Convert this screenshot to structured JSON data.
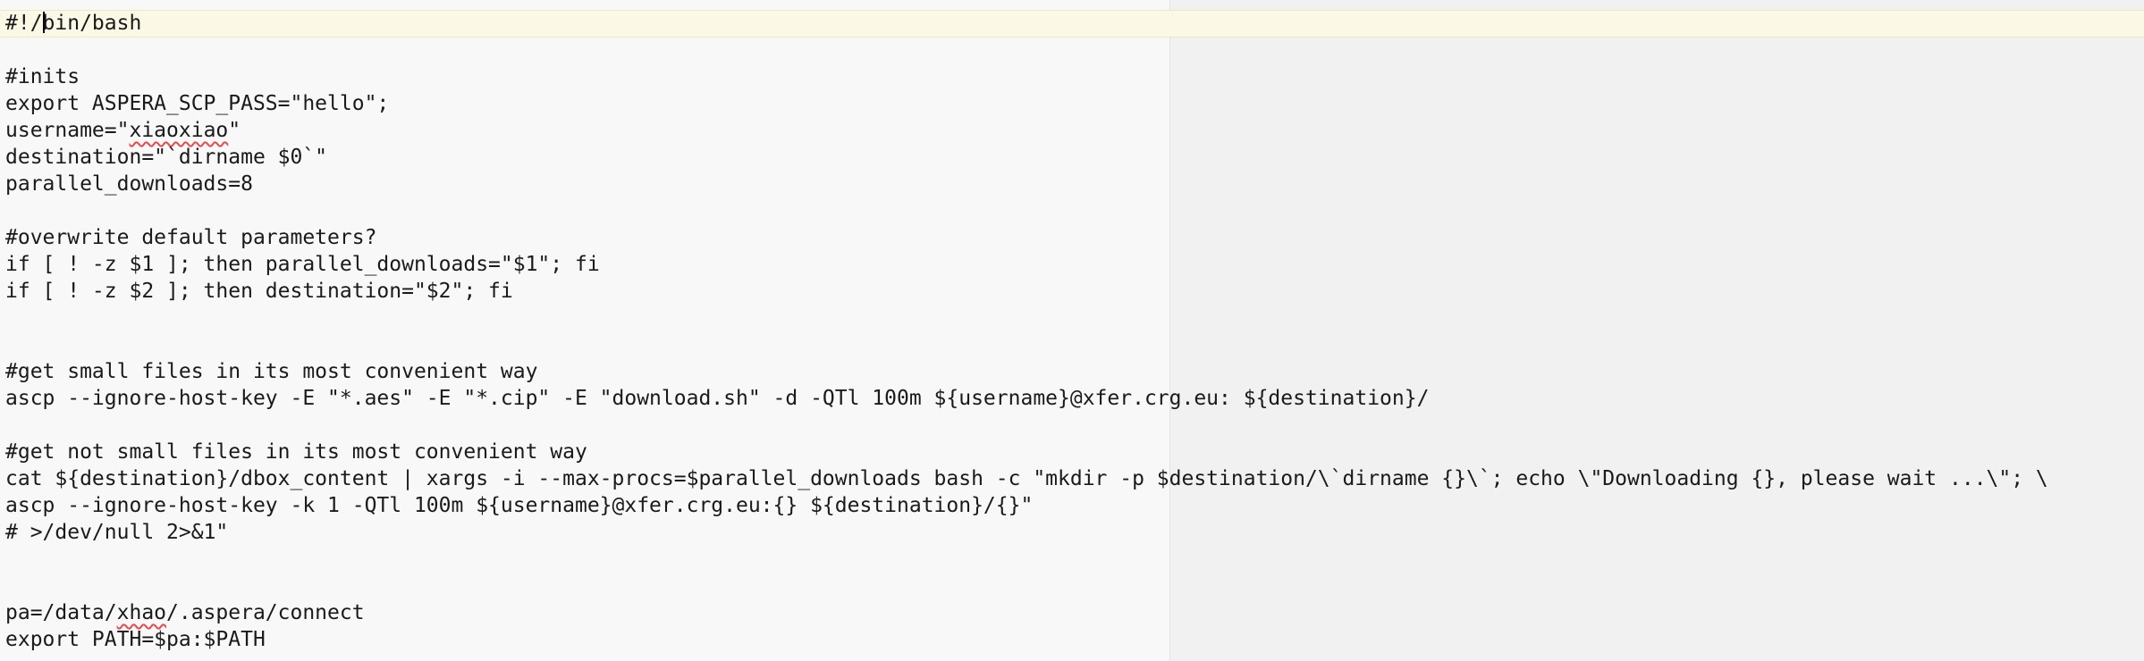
{
  "editor": {
    "lines": [
      {
        "segments": [
          "#!/",
          "bin/bash"
        ],
        "caret_after_first": true
      },
      {
        "text": ""
      },
      {
        "text": "#inits"
      },
      {
        "text": "export ASPERA_SCP_PASS=\"hello\";"
      },
      {
        "segments": [
          "username=\"",
          "xiaoxiao",
          "\""
        ],
        "misspelled_index": 1
      },
      {
        "text": "destination=\"`dirname $0`\""
      },
      {
        "text": "parallel_downloads=8"
      },
      {
        "text": ""
      },
      {
        "text": "#overwrite default parameters?"
      },
      {
        "text": "if [ ! -z $1 ]; then parallel_downloads=\"$1\"; fi"
      },
      {
        "text": "if [ ! -z $2 ]; then destination=\"$2\"; fi"
      },
      {
        "text": ""
      },
      {
        "text": ""
      },
      {
        "text": "#get small files in its most convenient way"
      },
      {
        "text": "ascp --ignore-host-key -E \"*.aes\" -E \"*.cip\" -E \"download.sh\" -d -QTl 100m ${username}@xfer.crg.eu: ${destination}/"
      },
      {
        "text": ""
      },
      {
        "text": "#get not small files in its most convenient way"
      },
      {
        "text": "cat ${destination}/dbox_content | xargs -i --max-procs=$parallel_downloads bash -c \"mkdir -p $destination/\\`dirname {}\\`; echo \\\"Downloading {}, please wait ...\\\"; \\"
      },
      {
        "text": "ascp --ignore-host-key -k 1 -QTl 100m ${username}@xfer.crg.eu:{} ${destination}/{}\""
      },
      {
        "text": "# >/dev/null 2>&1\""
      },
      {
        "text": ""
      },
      {
        "text": ""
      },
      {
        "segments": [
          "pa=/data/",
          "xhao",
          "/.aspera/connect"
        ],
        "misspelled_index": 1
      },
      {
        "text": "export PATH=$pa:$PATH"
      }
    ]
  },
  "colors": {
    "background": "#f8f8f8",
    "wrap_region": "#f1f1f1",
    "current_line": "#fbf9e6",
    "text": "#1a1a1a",
    "spellcheck": "#e64a4a"
  }
}
